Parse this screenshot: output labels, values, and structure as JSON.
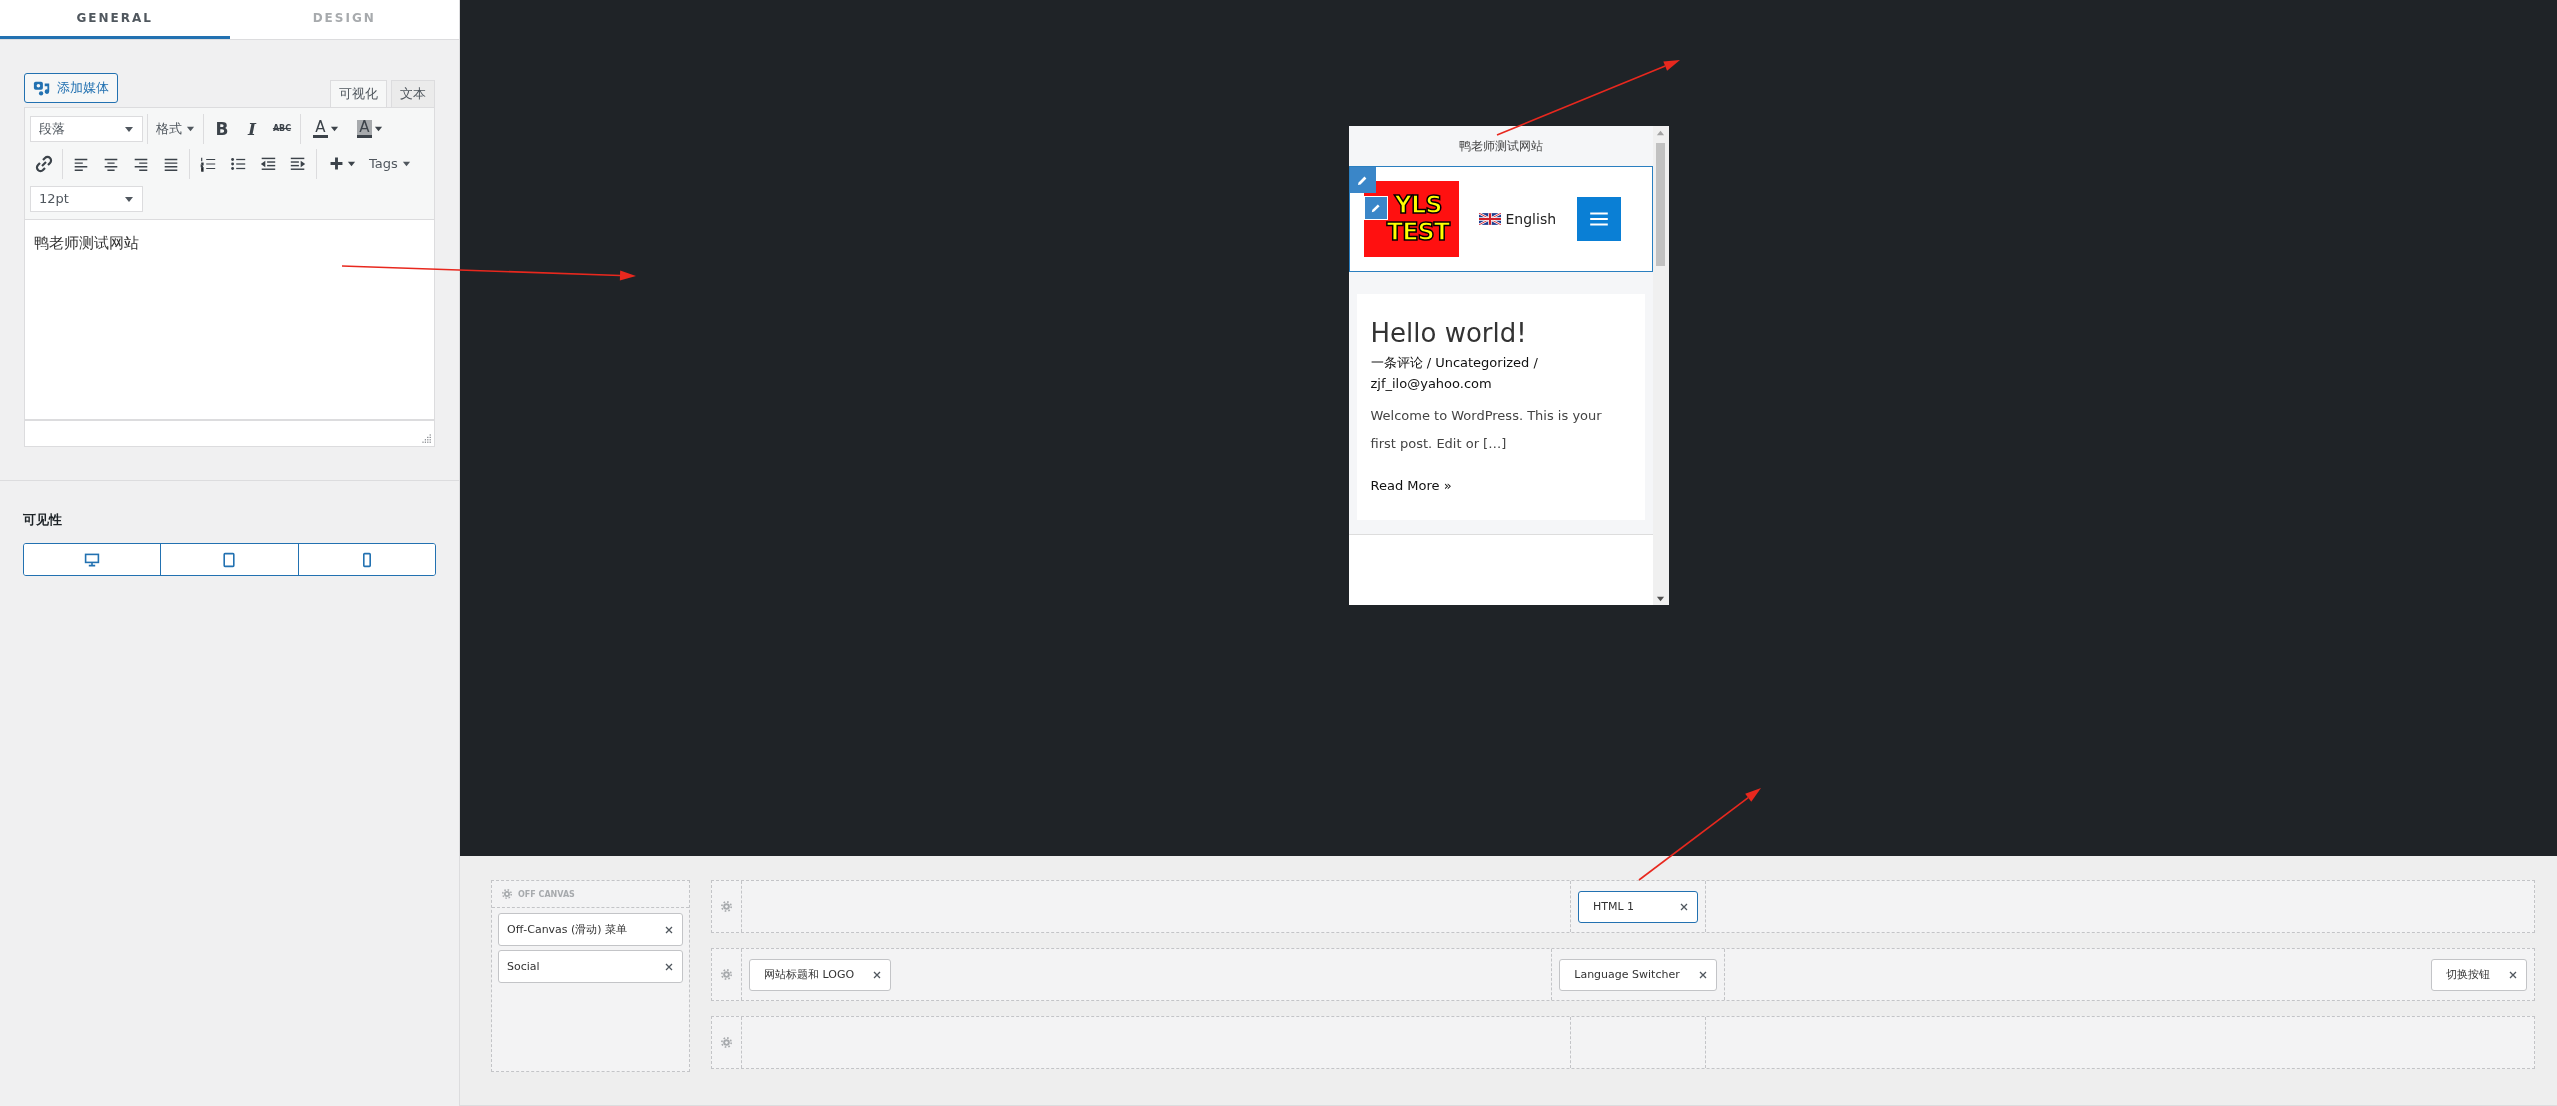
{
  "panel_tabs": [
    {
      "label": "GENERAL",
      "selected": true
    },
    {
      "label": "DESIGN",
      "selected": false
    }
  ],
  "editor": {
    "add_media": "添加媒体",
    "mode_tabs": [
      {
        "label": "可视化",
        "selected": true
      },
      {
        "label": "文本",
        "selected": false
      }
    ],
    "toolbar": [
      {
        "groups": [
          [
            {
              "kind": "select",
              "label": "段落"
            }
          ],
          [
            {
              "kind": "menu",
              "label": "格式"
            }
          ],
          [
            {
              "kind": "bold",
              "glyph": "B"
            },
            {
              "kind": "italic",
              "glyph": "I"
            },
            {
              "kind": "strike",
              "glyph": "ABC"
            }
          ],
          [
            {
              "kind": "text-color",
              "glyph": "A"
            },
            {
              "kind": "highlight",
              "glyph": "A"
            }
          ]
        ]
      },
      {
        "groups": [
          [
            {
              "kind": "link"
            }
          ],
          [
            {
              "kind": "align-left"
            },
            {
              "kind": "align-center"
            },
            {
              "kind": "align-right"
            },
            {
              "kind": "justify"
            }
          ],
          [
            {
              "kind": "ordered-list"
            },
            {
              "kind": "bullet-list"
            },
            {
              "kind": "outdent"
            },
            {
              "kind": "indent"
            }
          ],
          [
            {
              "kind": "insert"
            },
            {
              "kind": "menu",
              "label": "Tags"
            }
          ]
        ]
      },
      {
        "groups": [
          [
            {
              "kind": "select",
              "label": "12pt"
            }
          ]
        ]
      }
    ],
    "content": "鸭老师测试网站"
  },
  "visibility": {
    "title": "可见性",
    "devices": [
      {
        "kind": "desktop"
      },
      {
        "kind": "tablet"
      },
      {
        "kind": "phone"
      }
    ]
  },
  "preview": {
    "site_title": "鸭老师测试网站",
    "logo_lines": [
      "YLS",
      "TEST"
    ],
    "language": "English",
    "post": {
      "title": "Hello world!",
      "meta": "一条评论 / Uncategorized / zjf_ilo@yahoo.com",
      "excerpt": "Welcome to WordPress. This is your first post. Edit or […]",
      "read_more": "Read More »"
    }
  },
  "builder": {
    "off_canvas": {
      "title": "OFF CANVAS",
      "items": [
        {
          "label": "Off-Canvas (滑动) 菜单",
          "selected": false
        },
        {
          "label": "Social",
          "selected": false
        }
      ]
    },
    "rows": [
      {
        "left": [],
        "center": [
          {
            "label": "HTML 1",
            "selected": true
          }
        ],
        "right": []
      },
      {
        "left": [
          {
            "label": "网站标题和 LOGO",
            "selected": false
          }
        ],
        "center": [
          {
            "label": "Language Switcher",
            "selected": false
          }
        ],
        "right": [
          {
            "label": "切换按钮",
            "selected": false
          }
        ]
      },
      {
        "left": [],
        "center": [],
        "right": []
      }
    ]
  }
}
